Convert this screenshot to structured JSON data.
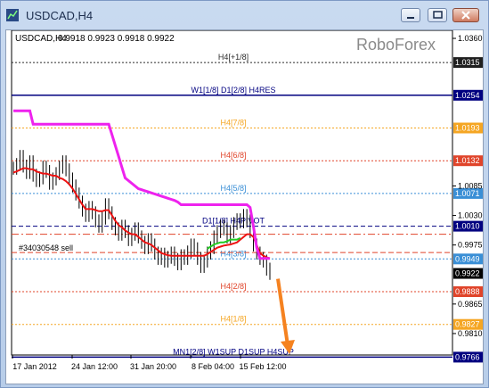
{
  "window": {
    "title": "USDCAD,H4"
  },
  "header": {
    "symbol": "USDCAD,H4",
    "ohlc": "0.9918 0.9923 0.9918 0.9922",
    "watermark": "RoboForex"
  },
  "colors": {
    "ma_red": "#ee1111",
    "envelope_magenta": "#ee22ee",
    "ma_green": "#22cc22",
    "arrow": "#f58220",
    "price_bars": "#000000"
  },
  "chart_data": {
    "type": "line",
    "y_axis": {
      "ticks": [
        1.036,
        1.0085,
        1.003,
        0.9975,
        0.9865,
        0.981
      ],
      "range": [
        0.977,
        1.0375
      ]
    },
    "x_axis": {
      "labels": [
        "17 Jan 2012",
        "24 Jan 12:00",
        "31 Jan 20:00",
        "8 Feb 04:00",
        "15 Feb 12:00"
      ]
    },
    "levels": [
      {
        "value": 1.0315,
        "label": "H4[+1/8]",
        "color": "#2b2b2b",
        "style": "dotted",
        "badge_bg": "#1f1f1f",
        "badge_fg": "#ffffff"
      },
      {
        "value": 1.0254,
        "label": "W1[1/8] D1[2/8] H4RES",
        "color": "#000080",
        "style": "solid",
        "badge_bg": "#000080",
        "badge_fg": "#ffffff"
      },
      {
        "value": 1.0193,
        "label": "H4[7/8]",
        "color": "#f5a623",
        "style": "dotted",
        "badge_bg": "#f5a623",
        "badge_fg": "#ffffff"
      },
      {
        "value": 1.0132,
        "label": "H4[6/8]",
        "color": "#e0442a",
        "style": "dotted",
        "badge_bg": "#e0442a",
        "badge_fg": "#ffffff"
      },
      {
        "value": 1.0071,
        "label": "H4[5/8]",
        "color": "#3a8fd6",
        "style": "dotted",
        "badge_bg": "#3a8fd6",
        "badge_fg": "#ffffff"
      },
      {
        "value": 1.001,
        "label": "D1[1/8] H4PIVOT",
        "color": "#000080",
        "style": "dashed",
        "badge_bg": "#000080",
        "badge_fg": "#ffffff"
      },
      {
        "value": 0.9949,
        "label": "H4[3/8]",
        "color": "#3a8fd6",
        "style": "dotted",
        "badge_bg": "#3a8fd6",
        "badge_fg": "#ffffff"
      },
      {
        "value": 0.9888,
        "label": "H4[2/8]",
        "color": "#e0442a",
        "style": "dotted",
        "badge_bg": "#e0442a",
        "badge_fg": "#ffffff"
      },
      {
        "value": 0.9827,
        "label": "H4[1/8]",
        "color": "#f5a623",
        "style": "dotted",
        "badge_bg": "#f5a623",
        "badge_fg": "#ffffff"
      },
      {
        "value": 0.9766,
        "label": "MN1[2/8] W1SUP D1SUP H4SUP",
        "color": "#000080",
        "style": "solid",
        "badge_bg": "#000080",
        "badge_fg": "#ffffff"
      }
    ],
    "current_price": {
      "value": 0.9922,
      "badge_bg": "#000000",
      "badge_fg": "#ffffff"
    },
    "order": {
      "label": "#34030548 sell",
      "value": 0.9961,
      "color": "#e0442a"
    },
    "sell_level": {
      "value": 0.9995,
      "color": "#e0442a"
    },
    "series": [
      {
        "key": "price",
        "values": [
          1.0118,
          1.0125,
          1.014,
          1.0122,
          1.011,
          1.013,
          1.0105,
          1.0095,
          1.01,
          1.012,
          1.0112,
          1.009,
          1.0098,
          1.0108,
          1.012,
          1.013,
          1.0115,
          1.0098,
          1.0085,
          1.007,
          1.0055,
          1.004,
          1.003,
          1.0045,
          1.0035,
          1.002,
          1.001,
          1.0025,
          1.005,
          1.0035,
          1.0015,
          1.0005,
          0.9995,
          1.001,
          1.0,
          0.9985,
          0.9995,
          1.0005,
          0.999,
          0.998,
          0.997,
          0.9985,
          0.9975,
          0.996,
          0.995,
          0.9958,
          0.9945,
          0.9952,
          0.996,
          0.9948,
          0.994,
          0.9955,
          0.995,
          0.9962,
          0.9975,
          0.9968,
          0.995,
          0.9935,
          0.9945,
          0.996,
          0.997,
          0.999,
          1.0,
          1.001,
          1.0005,
          0.999,
          1.0,
          1.0015,
          1.0022,
          1.0018,
          1.003,
          1.002,
          1.0,
          0.9975,
          0.996,
          0.995,
          0.9945,
          0.993,
          0.9922
        ]
      },
      {
        "key": "red_ma",
        "values": [
          1.011,
          1.0112,
          1.0115,
          1.0118,
          1.0118,
          1.0116,
          1.0116,
          1.0112,
          1.011,
          1.0108,
          1.0108,
          1.0106,
          1.0104,
          1.0104,
          1.01,
          1.0098,
          1.0094,
          1.0088,
          1.008,
          1.007,
          1.006,
          1.005,
          1.0042,
          1.0042,
          1.0042,
          1.004,
          1.0038,
          1.0038,
          1.004,
          1.004,
          1.003,
          1.002,
          1.0012,
          1.0008,
          1.0002,
          0.9998,
          0.9995,
          0.9995,
          0.999,
          0.9985,
          0.998,
          0.9978,
          0.9975,
          0.997,
          0.9965,
          0.996,
          0.9958,
          0.9956,
          0.9955,
          0.9955,
          0.9955,
          0.9955,
          0.9955,
          0.9955,
          0.9955,
          0.9955,
          0.9955,
          0.9955,
          0.9955,
          0.9958,
          0.9962,
          0.9966,
          0.997,
          0.9972,
          0.9974,
          0.9975,
          0.9976,
          0.9978,
          0.998,
          0.9985,
          0.999,
          0.9995,
          0.9995,
          0.999,
          0.9975,
          0.996,
          0.9955,
          0.9952,
          0.995
        ]
      },
      {
        "key": "magenta_env",
        "values": [
          1.0225,
          1.0225,
          1.0225,
          1.0225,
          1.0225,
          1.0225,
          1.02,
          1.02,
          1.02,
          1.02,
          1.02,
          1.02,
          1.02,
          1.02,
          1.02,
          1.02,
          1.02,
          1.02,
          1.02,
          1.02,
          1.02,
          1.02,
          1.02,
          1.02,
          1.02,
          1.02,
          1.02,
          1.02,
          1.02,
          1.02,
          1.018,
          1.016,
          1.014,
          1.012,
          1.01,
          1.0095,
          1.009,
          1.0085,
          1.008,
          1.0078,
          1.0076,
          1.0074,
          1.0072,
          1.007,
          1.0068,
          1.0066,
          1.0064,
          1.0062,
          1.006,
          1.0058,
          1.0055,
          1.005,
          1.005,
          1.005,
          1.005,
          1.005,
          1.005,
          1.005,
          1.005,
          1.005,
          1.005,
          1.005,
          1.005,
          1.005,
          1.005,
          1.005,
          1.005,
          1.005,
          1.005,
          1.005,
          1.005,
          1.005,
          1.0045,
          1.001,
          0.997,
          0.995,
          0.995,
          0.995,
          0.995
        ]
      },
      {
        "key": "green_ma",
        "values": [
          null,
          null,
          null,
          null,
          null,
          null,
          null,
          null,
          null,
          null,
          null,
          null,
          null,
          null,
          null,
          null,
          null,
          null,
          null,
          null,
          null,
          null,
          null,
          null,
          null,
          null,
          null,
          null,
          null,
          null,
          null,
          null,
          null,
          null,
          null,
          null,
          null,
          null,
          null,
          null,
          null,
          null,
          null,
          null,
          null,
          null,
          null,
          null,
          null,
          null,
          null,
          null,
          null,
          null,
          null,
          null,
          null,
          null,
          null,
          0.9968,
          0.9972,
          0.9976,
          0.9978,
          0.998,
          0.998,
          0.9982,
          0.9985,
          0.9985,
          0.9985,
          0.9988,
          null,
          null,
          null,
          null,
          null,
          null,
          null,
          null,
          null
        ]
      }
    ],
    "projection": {
      "from": 0.9912,
      "to": 0.9775,
      "label": ""
    }
  }
}
